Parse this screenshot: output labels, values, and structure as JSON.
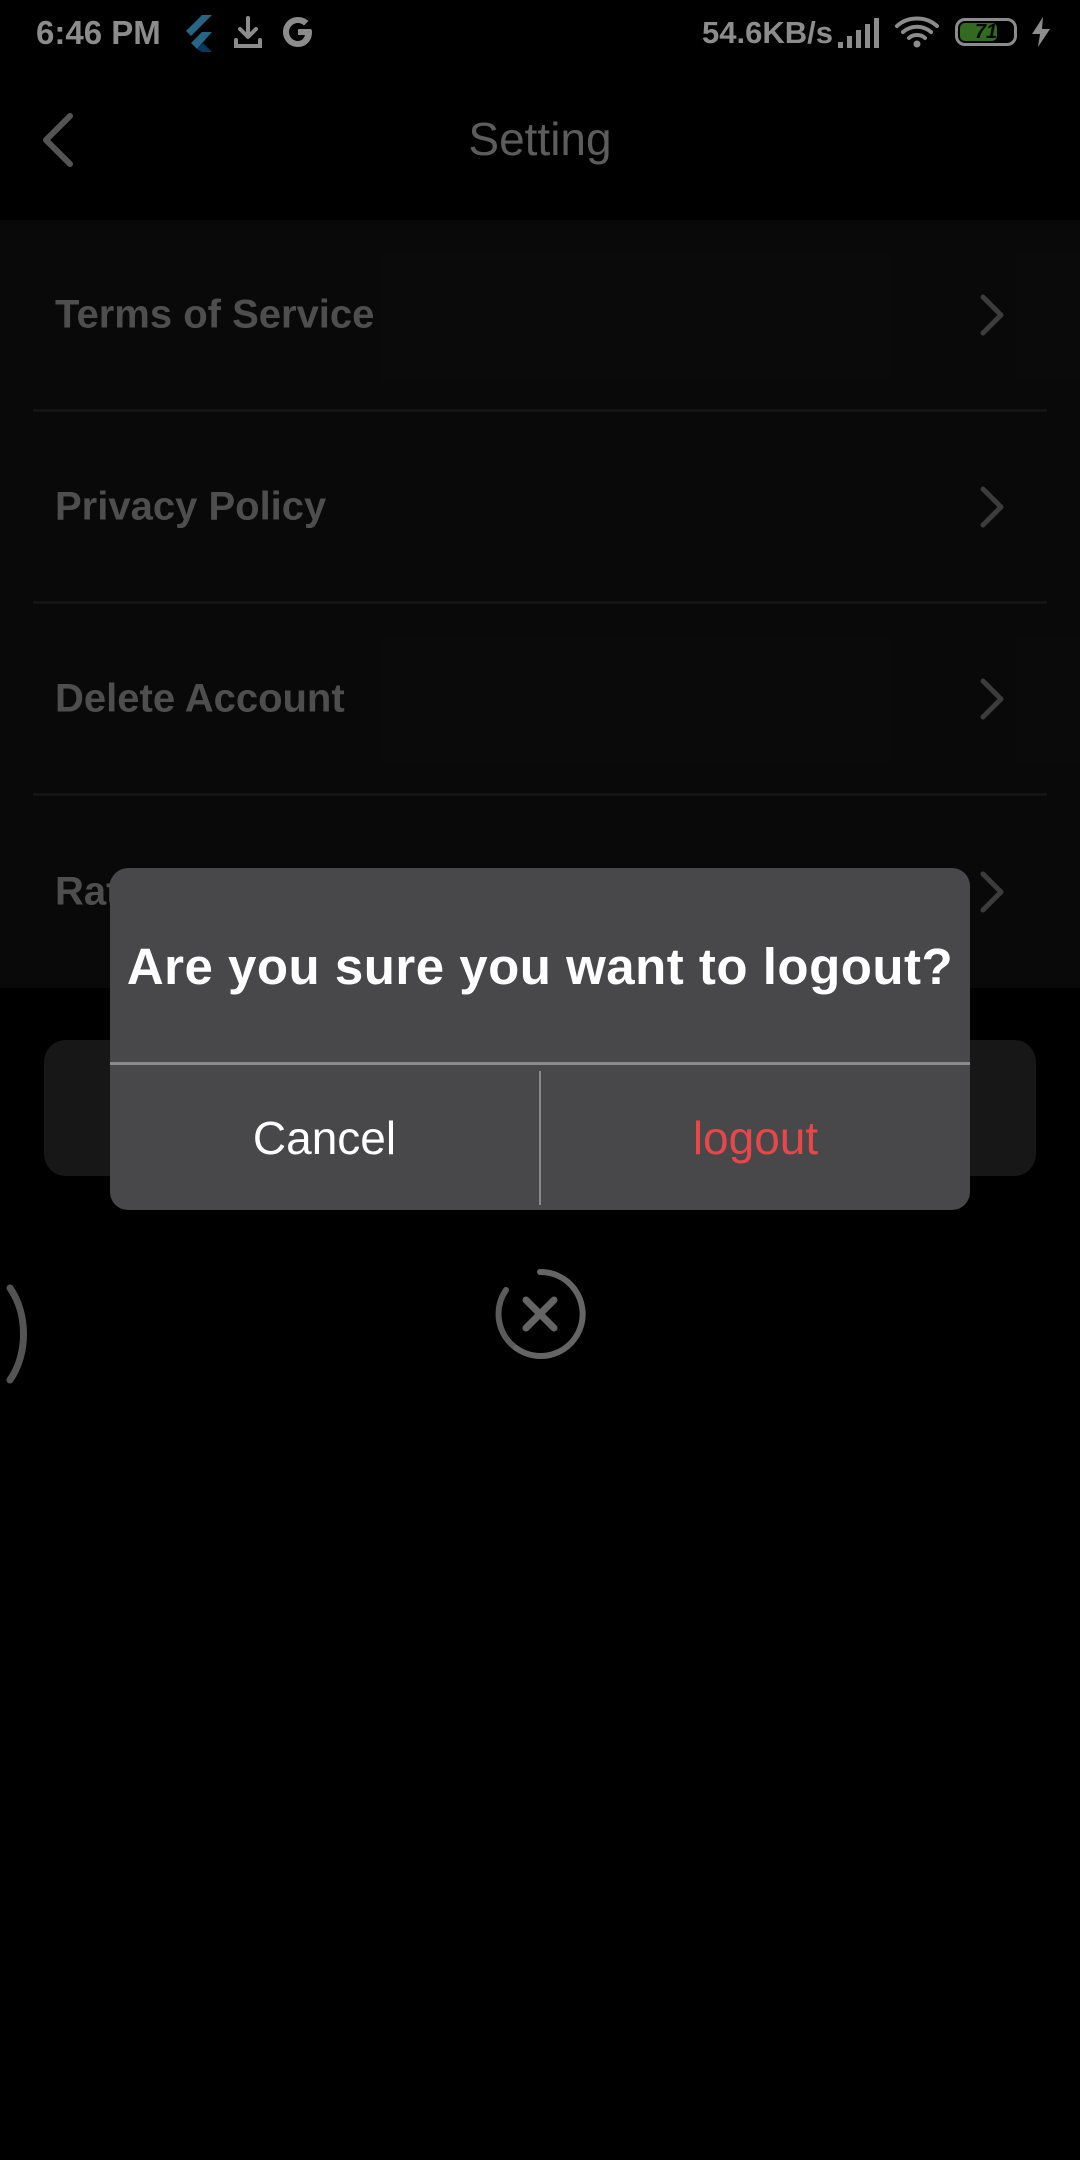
{
  "status_bar": {
    "time": "6:46 PM",
    "network_speed": "54.6KB/s",
    "battery_level": "71",
    "battery_fraction": 0.71,
    "icons": [
      "flutter-icon",
      "download-icon",
      "google-icon",
      "signal-icon",
      "wifi-icon",
      "battery-icon",
      "charging-icon"
    ],
    "battery_color": "#5cc23a"
  },
  "header": {
    "title": "Setting"
  },
  "settings": {
    "items": [
      {
        "label": "Terms of Service"
      },
      {
        "label": "Privacy Policy"
      },
      {
        "label": "Delete Account"
      },
      {
        "label": "Rate Us"
      }
    ]
  },
  "dialog": {
    "message": "Are you sure you want to logout?",
    "cancel_label": "Cancel",
    "confirm_label": "logout",
    "confirm_color": "#e8474a"
  }
}
